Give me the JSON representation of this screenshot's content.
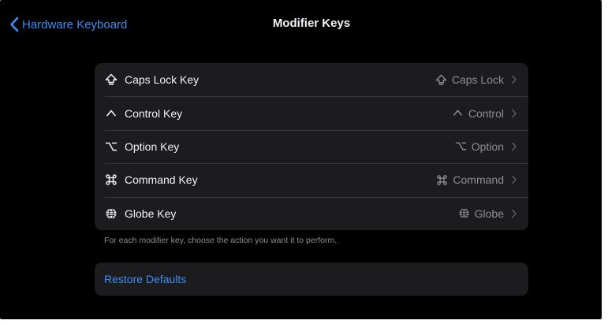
{
  "nav": {
    "back_label": "Hardware Keyboard",
    "title": "Modifier Keys"
  },
  "keys": [
    {
      "label": "Caps Lock Key",
      "icon": "caps-lock-icon",
      "value": "Caps Lock"
    },
    {
      "label": "Control Key",
      "icon": "control-icon",
      "value": "Control"
    },
    {
      "label": "Option Key",
      "icon": "option-icon",
      "value": "Option"
    },
    {
      "label": "Command Key",
      "icon": "command-icon",
      "value": "Command"
    },
    {
      "label": "Globe Key",
      "icon": "globe-icon",
      "value": "Globe"
    }
  ],
  "footer_note": "For each modifier key, choose the action you want it to perform.",
  "restore_label": "Restore Defaults",
  "colors": {
    "background": "#000000",
    "cell": "#1c1c1e",
    "accent": "#3c8cf3",
    "primary_text": "#f2f2f7",
    "secondary_text": "#8e8e93",
    "separator": "#38383a"
  }
}
